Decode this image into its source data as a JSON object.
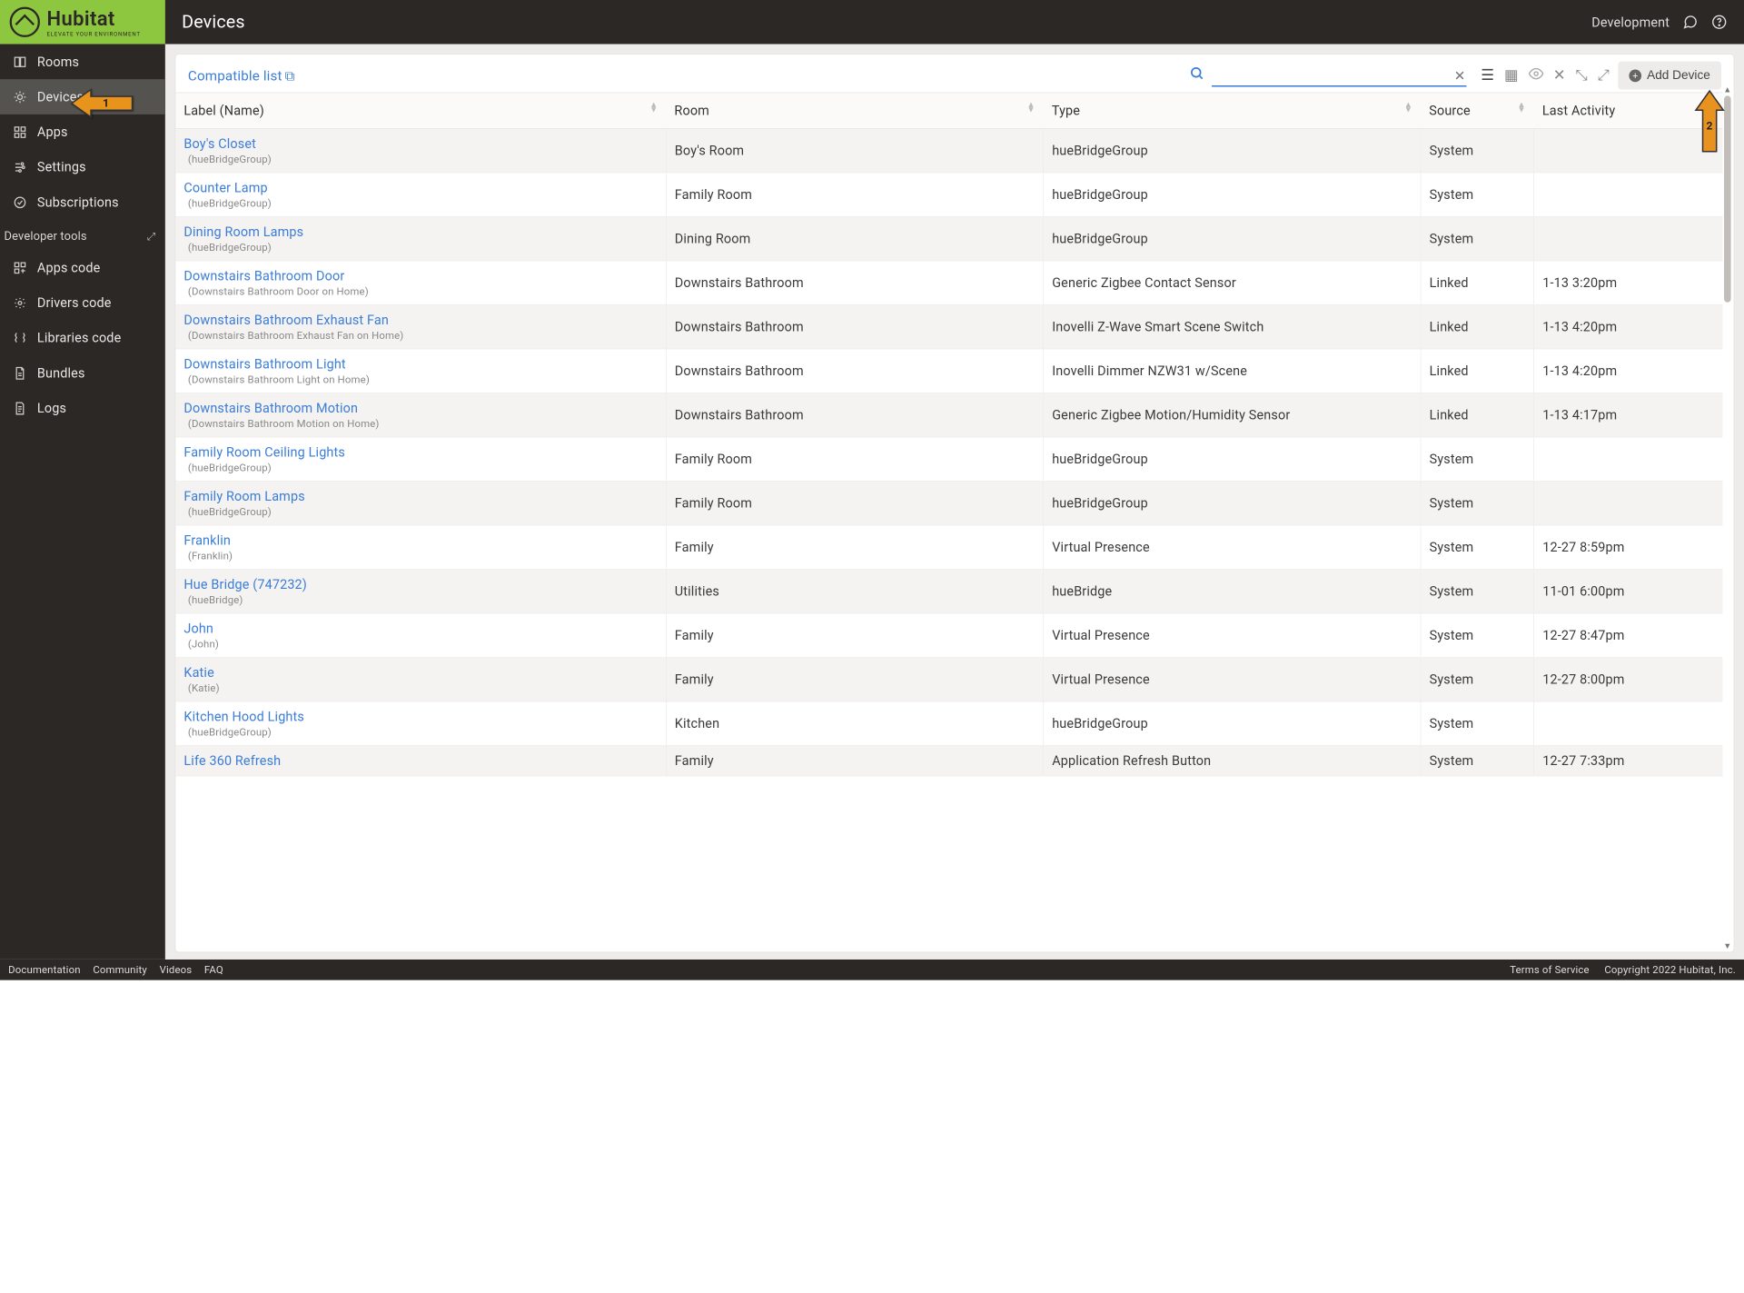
{
  "brand": {
    "name": "Hubitat",
    "tagline": "ELEVATE YOUR ENVIRONMENT"
  },
  "header": {
    "title": "Devices",
    "mode": "Development"
  },
  "sidebar": {
    "items": [
      "Rooms",
      "Devices",
      "Apps",
      "Settings",
      "Subscriptions"
    ],
    "dev_header": "Developer tools",
    "dev_items": [
      "Apps code",
      "Drivers code",
      "Libraries code",
      "Bundles",
      "Logs"
    ]
  },
  "toolbar": {
    "compat": "Compatible list",
    "search_value": "",
    "add_label": "Add Device"
  },
  "columns": [
    "Label (Name)",
    "Room",
    "Type",
    "Source",
    "Last Activity"
  ],
  "devices": [
    {
      "label": "Boy's Closet",
      "sub": "(hueBridgeGroup)",
      "room": "Boy's Room",
      "type": "hueBridgeGroup",
      "source": "System",
      "activity": ""
    },
    {
      "label": "Counter Lamp",
      "sub": "(hueBridgeGroup)",
      "room": "Family Room",
      "type": "hueBridgeGroup",
      "source": "System",
      "activity": ""
    },
    {
      "label": "Dining Room Lamps",
      "sub": "(hueBridgeGroup)",
      "room": "Dining Room",
      "type": "hueBridgeGroup",
      "source": "System",
      "activity": ""
    },
    {
      "label": "Downstairs Bathroom Door",
      "sub": "(Downstairs Bathroom Door on Home)",
      "room": "Downstairs Bathroom",
      "type": "Generic Zigbee Contact Sensor",
      "source": "Linked",
      "activity": "1-13 3:20pm"
    },
    {
      "label": "Downstairs Bathroom Exhaust Fan",
      "sub": "(Downstairs Bathroom Exhaust Fan on Home)",
      "room": "Downstairs Bathroom",
      "type": "Inovelli Z-Wave Smart Scene Switch",
      "source": "Linked",
      "activity": "1-13 4:20pm"
    },
    {
      "label": "Downstairs Bathroom Light",
      "sub": "(Downstairs Bathroom Light on Home)",
      "room": "Downstairs Bathroom",
      "type": "Inovelli Dimmer NZW31 w/Scene",
      "source": "Linked",
      "activity": "1-13 4:20pm"
    },
    {
      "label": "Downstairs Bathroom Motion",
      "sub": "(Downstairs Bathroom Motion on Home)",
      "room": "Downstairs Bathroom",
      "type": "Generic Zigbee Motion/Humidity Sensor",
      "source": "Linked",
      "activity": "1-13 4:17pm"
    },
    {
      "label": "Family Room Ceiling Lights",
      "sub": "(hueBridgeGroup)",
      "room": "Family Room",
      "type": "hueBridgeGroup",
      "source": "System",
      "activity": ""
    },
    {
      "label": "Family Room Lamps",
      "sub": "(hueBridgeGroup)",
      "room": "Family Room",
      "type": "hueBridgeGroup",
      "source": "System",
      "activity": ""
    },
    {
      "label": "Franklin",
      "sub": "(Franklin)",
      "room": "Family",
      "type": "Virtual Presence",
      "source": "System",
      "activity": "12-27 8:59pm"
    },
    {
      "label": "Hue Bridge (747232)",
      "sub": "(hueBridge)",
      "room": "Utilities",
      "type": "hueBridge",
      "source": "System",
      "activity": "11-01 6:00pm"
    },
    {
      "label": "John",
      "sub": "(John)",
      "room": "Family",
      "type": "Virtual Presence",
      "source": "System",
      "activity": "12-27 8:47pm"
    },
    {
      "label": "Katie",
      "sub": "(Katie)",
      "room": "Family",
      "type": "Virtual Presence",
      "source": "System",
      "activity": "12-27 8:00pm"
    },
    {
      "label": "Kitchen Hood Lights",
      "sub": "(hueBridgeGroup)",
      "room": "Kitchen",
      "type": "hueBridgeGroup",
      "source": "System",
      "activity": ""
    },
    {
      "label": "Life 360 Refresh",
      "sub": "",
      "room": "Family",
      "type": "Application Refresh Button",
      "source": "System",
      "activity": "12-27 7:33pm"
    }
  ],
  "footer": {
    "links": [
      "Documentation",
      "Community",
      "Videos",
      "FAQ"
    ],
    "tos": "Terms of Service",
    "copyright": "Copyright 2022 Hubitat, Inc."
  }
}
